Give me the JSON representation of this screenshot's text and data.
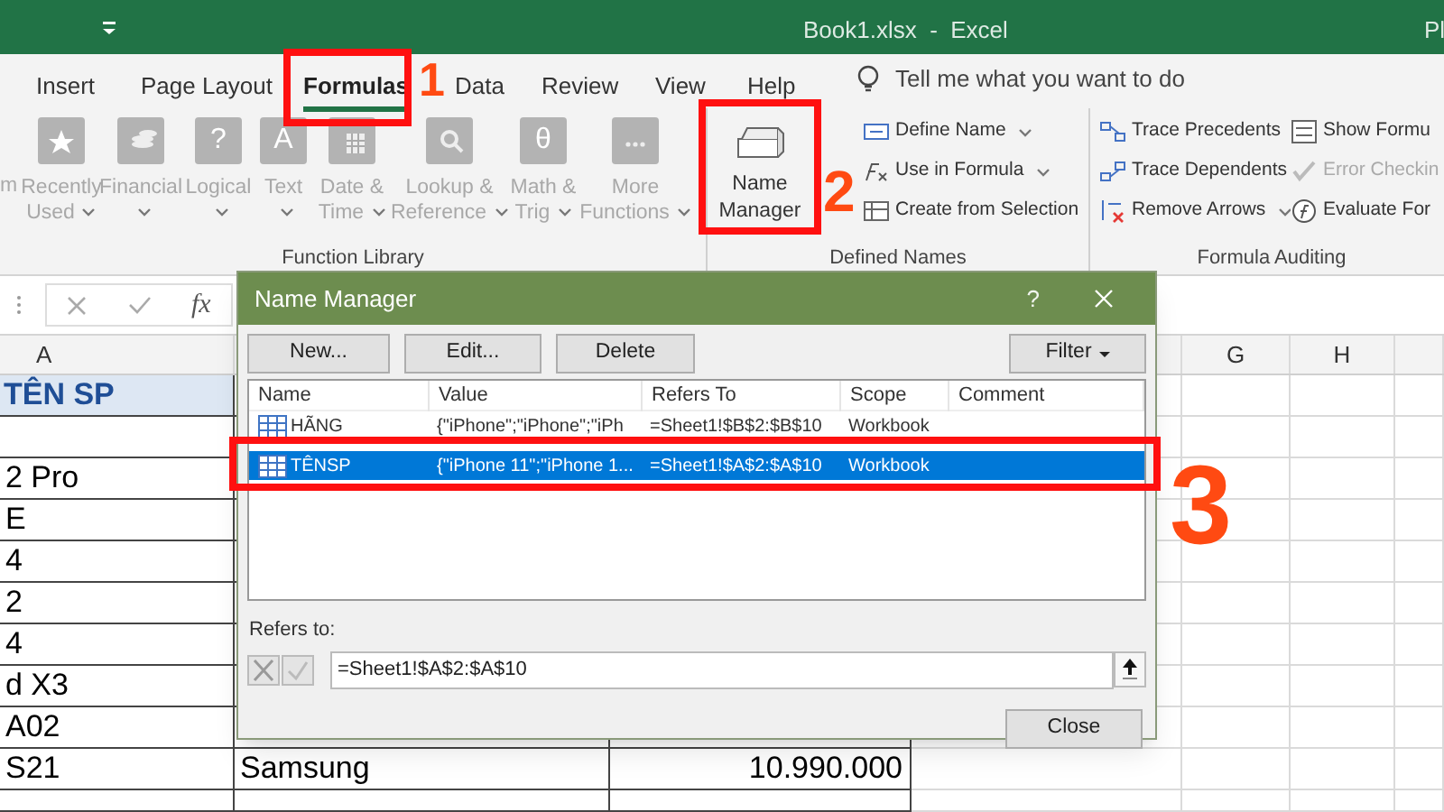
{
  "window": {
    "title": "Book1.xlsx  -  Excel",
    "title_right_partial": "Pl"
  },
  "ribbon_tabs": [
    {
      "label": "Insert",
      "selected": false
    },
    {
      "label": "Page Layout",
      "selected": false
    },
    {
      "label": "Formulas",
      "selected": true
    },
    {
      "label": "Data",
      "selected": false
    },
    {
      "label": "Review",
      "selected": false
    },
    {
      "label": "View",
      "selected": false
    },
    {
      "label": "Help",
      "selected": false
    }
  ],
  "tell_me": {
    "placeholder": "Tell me what you want to do"
  },
  "function_library": {
    "label": "Function Library",
    "partial_label": "m",
    "buttons": [
      {
        "lines": [
          "Recently",
          "Used"
        ],
        "caret": true,
        "disabled": true
      },
      {
        "lines": [
          "Financial"
        ],
        "caret": true,
        "disabled": true
      },
      {
        "lines": [
          "Logical"
        ],
        "caret": true,
        "disabled": true,
        "glyph": "?"
      },
      {
        "lines": [
          "Text"
        ],
        "caret": true,
        "disabled": true,
        "glyph": "A"
      },
      {
        "lines": [
          "Date &",
          "Time"
        ],
        "caret": true,
        "disabled": true
      },
      {
        "lines": [
          "Lookup &",
          "Reference"
        ],
        "caret": true,
        "disabled": true
      },
      {
        "lines": [
          "Math &",
          "Trig"
        ],
        "caret": true,
        "disabled": true,
        "glyph": "θ"
      },
      {
        "lines": [
          "More",
          "Functions"
        ],
        "caret": true,
        "disabled": true
      }
    ]
  },
  "defined_names": {
    "label": "Defined Names",
    "name_manager": {
      "lines": [
        "Name",
        "Manager"
      ],
      "disabled": false
    },
    "items": [
      {
        "label": "Define Name",
        "caret": true
      },
      {
        "label": "Use in Formula",
        "caret": true
      },
      {
        "label": "Create from Selection",
        "caret": false
      }
    ]
  },
  "formula_auditing": {
    "label": "Formula Auditing",
    "items": [
      {
        "label": "Trace Precedents",
        "caret": false,
        "disabled": false
      },
      {
        "label": "Trace Dependents",
        "caret": false,
        "disabled": false
      },
      {
        "label": "Remove Arrows",
        "caret": true,
        "disabled": false
      },
      {
        "label": "Show Formu",
        "caret": false,
        "disabled": false
      },
      {
        "label": "Error Checkin",
        "caret": false,
        "disabled": true
      },
      {
        "label": "Evaluate For",
        "caret": false,
        "disabled": false
      }
    ]
  },
  "formula_bar": {
    "fx": "fx"
  },
  "sheet": {
    "columns": [
      "A",
      "G",
      "H"
    ],
    "header_cell": "TÊN SP",
    "rows": [
      {
        "a": "2 Pro"
      },
      {
        "a": "E"
      },
      {
        "a": "4"
      },
      {
        "a": "2"
      },
      {
        "a": "4"
      },
      {
        "a": "d X3"
      },
      {
        "a": "A02"
      },
      {
        "a": "S21",
        "b": "Samsung",
        "c": "10.990.000"
      }
    ]
  },
  "dialog": {
    "title": "Name Manager",
    "help": "?",
    "buttons": [
      "New...",
      "Edit...",
      "Delete"
    ],
    "filter": "Filter",
    "columns": [
      "Name",
      "Value",
      "Refers To",
      "Scope",
      "Comment"
    ],
    "names": [
      {
        "name": "HÃNG",
        "value": "{\"iPhone\";\"iPhone\";\"iPh",
        "refers_to": "=Sheet1!$B$2:$B$10",
        "scope": "Workbook",
        "selected": false
      },
      {
        "name": "TÊNSP",
        "value": "{\"iPhone 11\";\"iPhone 1...",
        "refers_to": "=Sheet1!$A$2:$A$10",
        "scope": "Workbook",
        "selected": true
      }
    ],
    "refers_label": "Refers to:",
    "refers_value": "=Sheet1!$A$2:$A$10",
    "close": "Close"
  },
  "annotations": [
    "1",
    "2",
    "3"
  ]
}
